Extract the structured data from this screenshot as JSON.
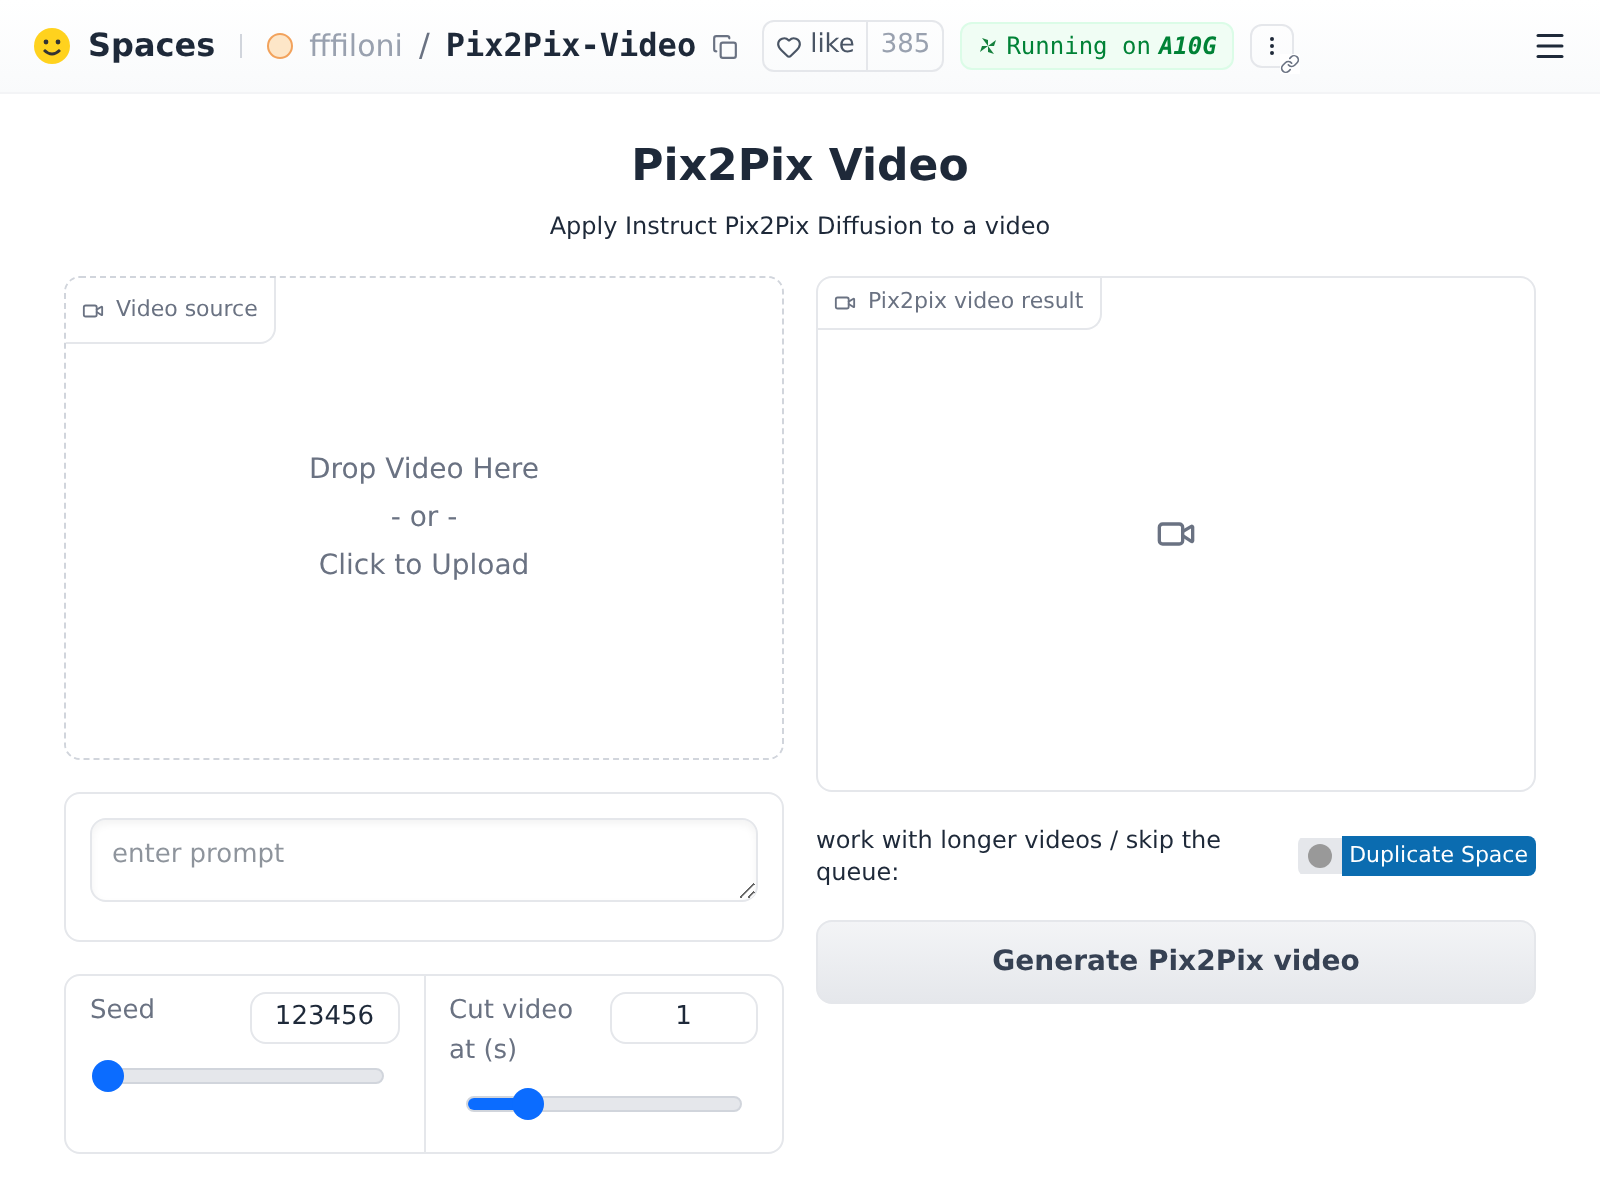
{
  "header": {
    "brand": "Spaces",
    "owner": "fffiloni",
    "separator": "/",
    "repo": "Pix2Pix-Video",
    "like_label": "like",
    "like_count": "385",
    "status": "Running on",
    "hardware": "A10G"
  },
  "title": "Pix2Pix Video",
  "subtitle": "Apply Instruct Pix2Pix Diffusion to a video",
  "video_source": {
    "label": "Video source",
    "lines": [
      "Drop Video Here",
      "- or -",
      "Click to Upload"
    ]
  },
  "prompt": {
    "placeholder": "enter prompt"
  },
  "sliders": [
    {
      "label": "Seed",
      "value": "123456",
      "level": 0
    },
    {
      "label": "Cut video at (s)",
      "value": "1",
      "level": 0.22
    }
  ],
  "result": {
    "label": "Pix2pix video result"
  },
  "duplicate": {
    "text": "work with longer videos / skip the queue:",
    "button": "Duplicate Space"
  },
  "generate_button": "Generate Pix2Pix video"
}
